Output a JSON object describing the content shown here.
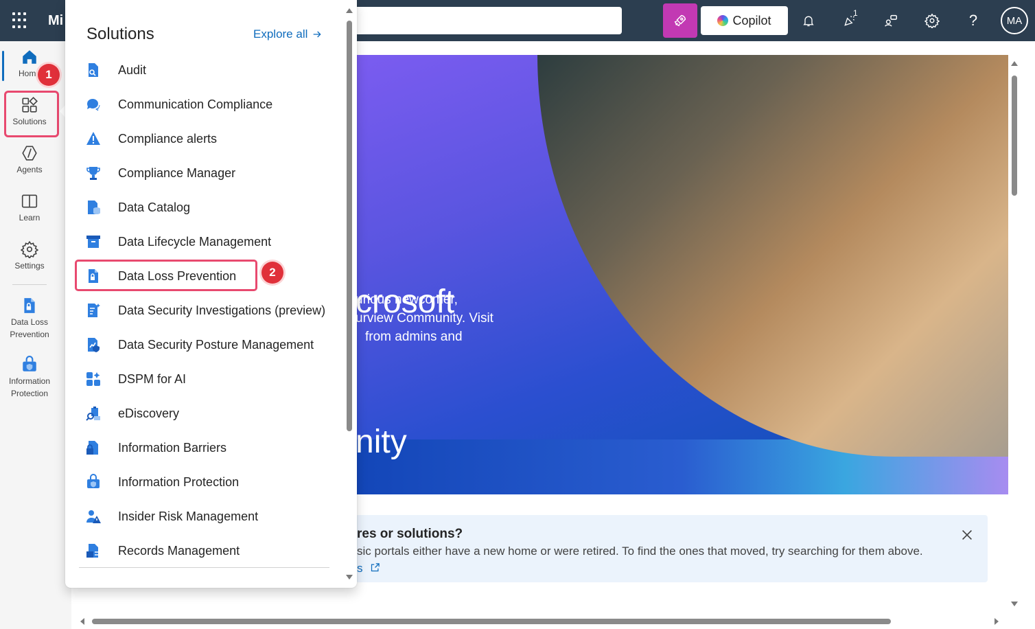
{
  "topbar": {
    "brand": "Mi",
    "copilot_label": "Copilot",
    "notification_count": "1",
    "avatar_initials": "MA"
  },
  "rail": {
    "items": [
      {
        "label": "Home",
        "icon": "home-icon"
      },
      {
        "label": "Solutions",
        "icon": "solutions-icon"
      },
      {
        "label": "Agents",
        "icon": "agents-icon"
      },
      {
        "label": "Learn",
        "icon": "learn-icon"
      },
      {
        "label": "Settings",
        "icon": "settings-icon"
      },
      {
        "label": "Data Loss Prevention",
        "icon": "dlp-icon"
      },
      {
        "label": "Information Protection",
        "icon": "information-protection-icon"
      }
    ]
  },
  "annotations": {
    "step1": "1",
    "step2": "2"
  },
  "flyout": {
    "title": "Solutions",
    "explore_label": "Explore all",
    "items": [
      {
        "label": "Audit",
        "icon": "audit-icon"
      },
      {
        "label": "Communication Compliance",
        "icon": "communication-compliance-icon"
      },
      {
        "label": "Compliance alerts",
        "icon": "alert-icon"
      },
      {
        "label": "Compliance Manager",
        "icon": "trophy-icon"
      },
      {
        "label": "Data Catalog",
        "icon": "data-catalog-icon"
      },
      {
        "label": "Data Lifecycle Management",
        "icon": "archive-icon"
      },
      {
        "label": "Data Loss Prevention",
        "icon": "dlp-icon"
      },
      {
        "label": "Data Security Investigations (preview)",
        "icon": "investigation-icon"
      },
      {
        "label": "Data Security Posture Management",
        "icon": "posture-icon"
      },
      {
        "label": "DSPM for AI",
        "icon": "dspm-ai-icon"
      },
      {
        "label": "eDiscovery",
        "icon": "ediscovery-icon"
      },
      {
        "label": "Information Barriers",
        "icon": "barrier-icon"
      },
      {
        "label": "Information Protection",
        "icon": "information-protection-icon"
      },
      {
        "label": "Insider Risk Management",
        "icon": "insider-risk-icon"
      },
      {
        "label": "Records Management",
        "icon": "records-icon"
      }
    ]
  },
  "hero": {
    "title_lines": [
      "crosoft",
      "nity"
    ],
    "desc_lines": [
      "urious newcomer,",
      "urview Community. Visit",
      "from admins and"
    ]
  },
  "info_banner": {
    "title": "res or solutions?",
    "text": "sic portals either have a new home or were retired. To find the ones that moved, try searching for them above.",
    "link": "s"
  },
  "colors": {
    "topbar": "#2c3e50",
    "accent": "#0f6cbd",
    "highlight": "#e8496f",
    "badge": "#e0303a",
    "rocket": "#c239b3"
  }
}
